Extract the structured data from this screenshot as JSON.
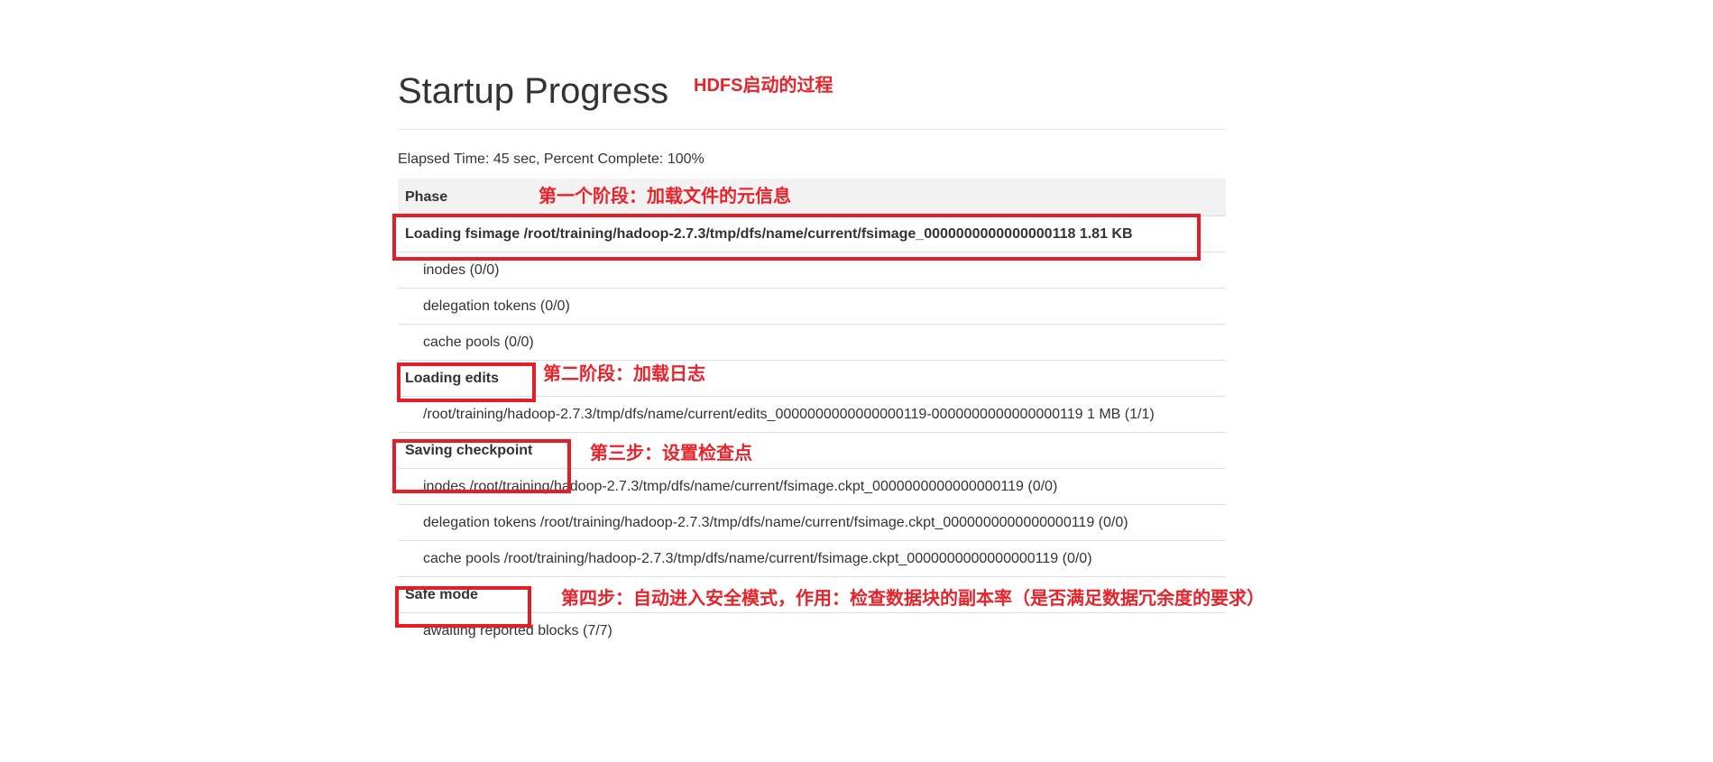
{
  "page": {
    "title": "Startup Progress",
    "elapsed": "Elapsed Time: 45 sec, Percent Complete: 100%"
  },
  "table": {
    "header": "Phase",
    "rows": [
      {
        "kind": "phase",
        "text": "Loading fsimage /root/training/hadoop-2.7.3/tmp/dfs/name/current/fsimage_0000000000000000118 1.81 KB"
      },
      {
        "kind": "step",
        "text": "inodes (0/0)"
      },
      {
        "kind": "step",
        "text": "delegation tokens (0/0)"
      },
      {
        "kind": "step",
        "text": "cache pools (0/0)"
      },
      {
        "kind": "phase",
        "text": "Loading edits"
      },
      {
        "kind": "step",
        "text": "/root/training/hadoop-2.7.3/tmp/dfs/name/current/edits_0000000000000000119-0000000000000000119 1 MB (1/1)"
      },
      {
        "kind": "phase",
        "text": "Saving checkpoint"
      },
      {
        "kind": "step",
        "text": "inodes /root/training/hadoop-2.7.3/tmp/dfs/name/current/fsimage.ckpt_0000000000000000119 (0/0)"
      },
      {
        "kind": "step",
        "text": "delegation tokens /root/training/hadoop-2.7.3/tmp/dfs/name/current/fsimage.ckpt_0000000000000000119 (0/0)"
      },
      {
        "kind": "step",
        "text": "cache pools /root/training/hadoop-2.7.3/tmp/dfs/name/current/fsimage.ckpt_0000000000000000119 (0/0)"
      },
      {
        "kind": "phase",
        "text": "Safe mode"
      },
      {
        "kind": "step",
        "text": "awaiting reported blocks (7/7)"
      }
    ]
  },
  "annotations": {
    "title_note": "HDFS启动的过程",
    "stage1": "第一个阶段：加载文件的元信息",
    "stage2": "第二阶段：加载日志",
    "stage3": "第三步：设置检查点",
    "stage4": "第四步：自动进入安全模式，作用：检查数据块的副本率（是否满足数据冗余度的要求）"
  },
  "colors": {
    "annotation": "#e8232b",
    "highlight_box": "#e41e26",
    "header_bg": "#f2f2f2",
    "text": "#333333"
  }
}
